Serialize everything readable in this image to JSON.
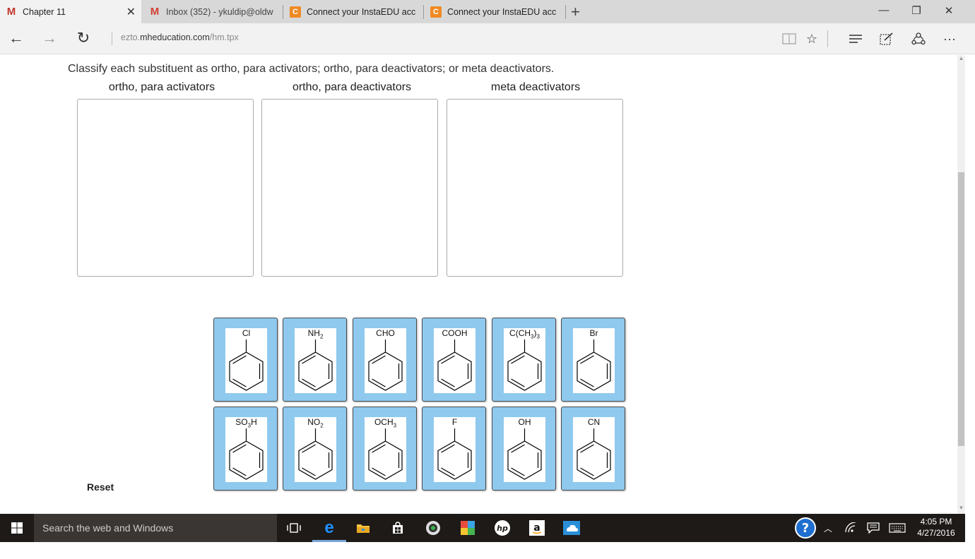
{
  "browser": {
    "tabs": [
      {
        "icon": "mheducation-icon",
        "title": "Chapter 11",
        "active": true
      },
      {
        "icon": "gmail-icon",
        "title": "Inbox (352) - ykuldip@oldw"
      },
      {
        "icon": "connect-icon",
        "title": "Connect your InstaEDU acc"
      },
      {
        "icon": "connect-icon",
        "title": "Connect your InstaEDU acc"
      }
    ],
    "url_prefix": "ezto.",
    "url_domain": "mheducation.com",
    "url_path": "/hm.tpx"
  },
  "question": {
    "prompt": "Classify each substituent as ortho, para activators; ortho, para deactivators; or meta deactivators.",
    "bins": [
      {
        "label": "ortho, para activators"
      },
      {
        "label": "ortho, para deactivators"
      },
      {
        "label": "meta deactivators"
      }
    ],
    "cards_row1": [
      {
        "name": "Cl",
        "html": "Cl"
      },
      {
        "name": "NH2",
        "html": "NH<sub>2</sub>"
      },
      {
        "name": "CHO",
        "html": "CHO"
      },
      {
        "name": "COOH",
        "html": "COOH"
      },
      {
        "name": "C(CH3)3",
        "html": "C(CH<sub>3</sub>)<sub>3</sub>"
      },
      {
        "name": "Br",
        "html": "Br"
      }
    ],
    "cards_row2": [
      {
        "name": "SO3H",
        "html": "SO<sub>3</sub>H"
      },
      {
        "name": "NO2",
        "html": "NO<sub>2</sub>"
      },
      {
        "name": "OCH3",
        "html": "OCH<sub>3</sub>"
      },
      {
        "name": "F",
        "html": "F"
      },
      {
        "name": "OH",
        "html": "OH"
      },
      {
        "name": "CN",
        "html": "CN"
      }
    ],
    "reset_label": "Reset"
  },
  "taskbar": {
    "search_placeholder": "Search the web and Windows",
    "time": "4:05 PM",
    "date": "4/27/2016"
  },
  "colors": {
    "card_fill": "#8fc9ee",
    "taskbar": "#1e1a18"
  }
}
